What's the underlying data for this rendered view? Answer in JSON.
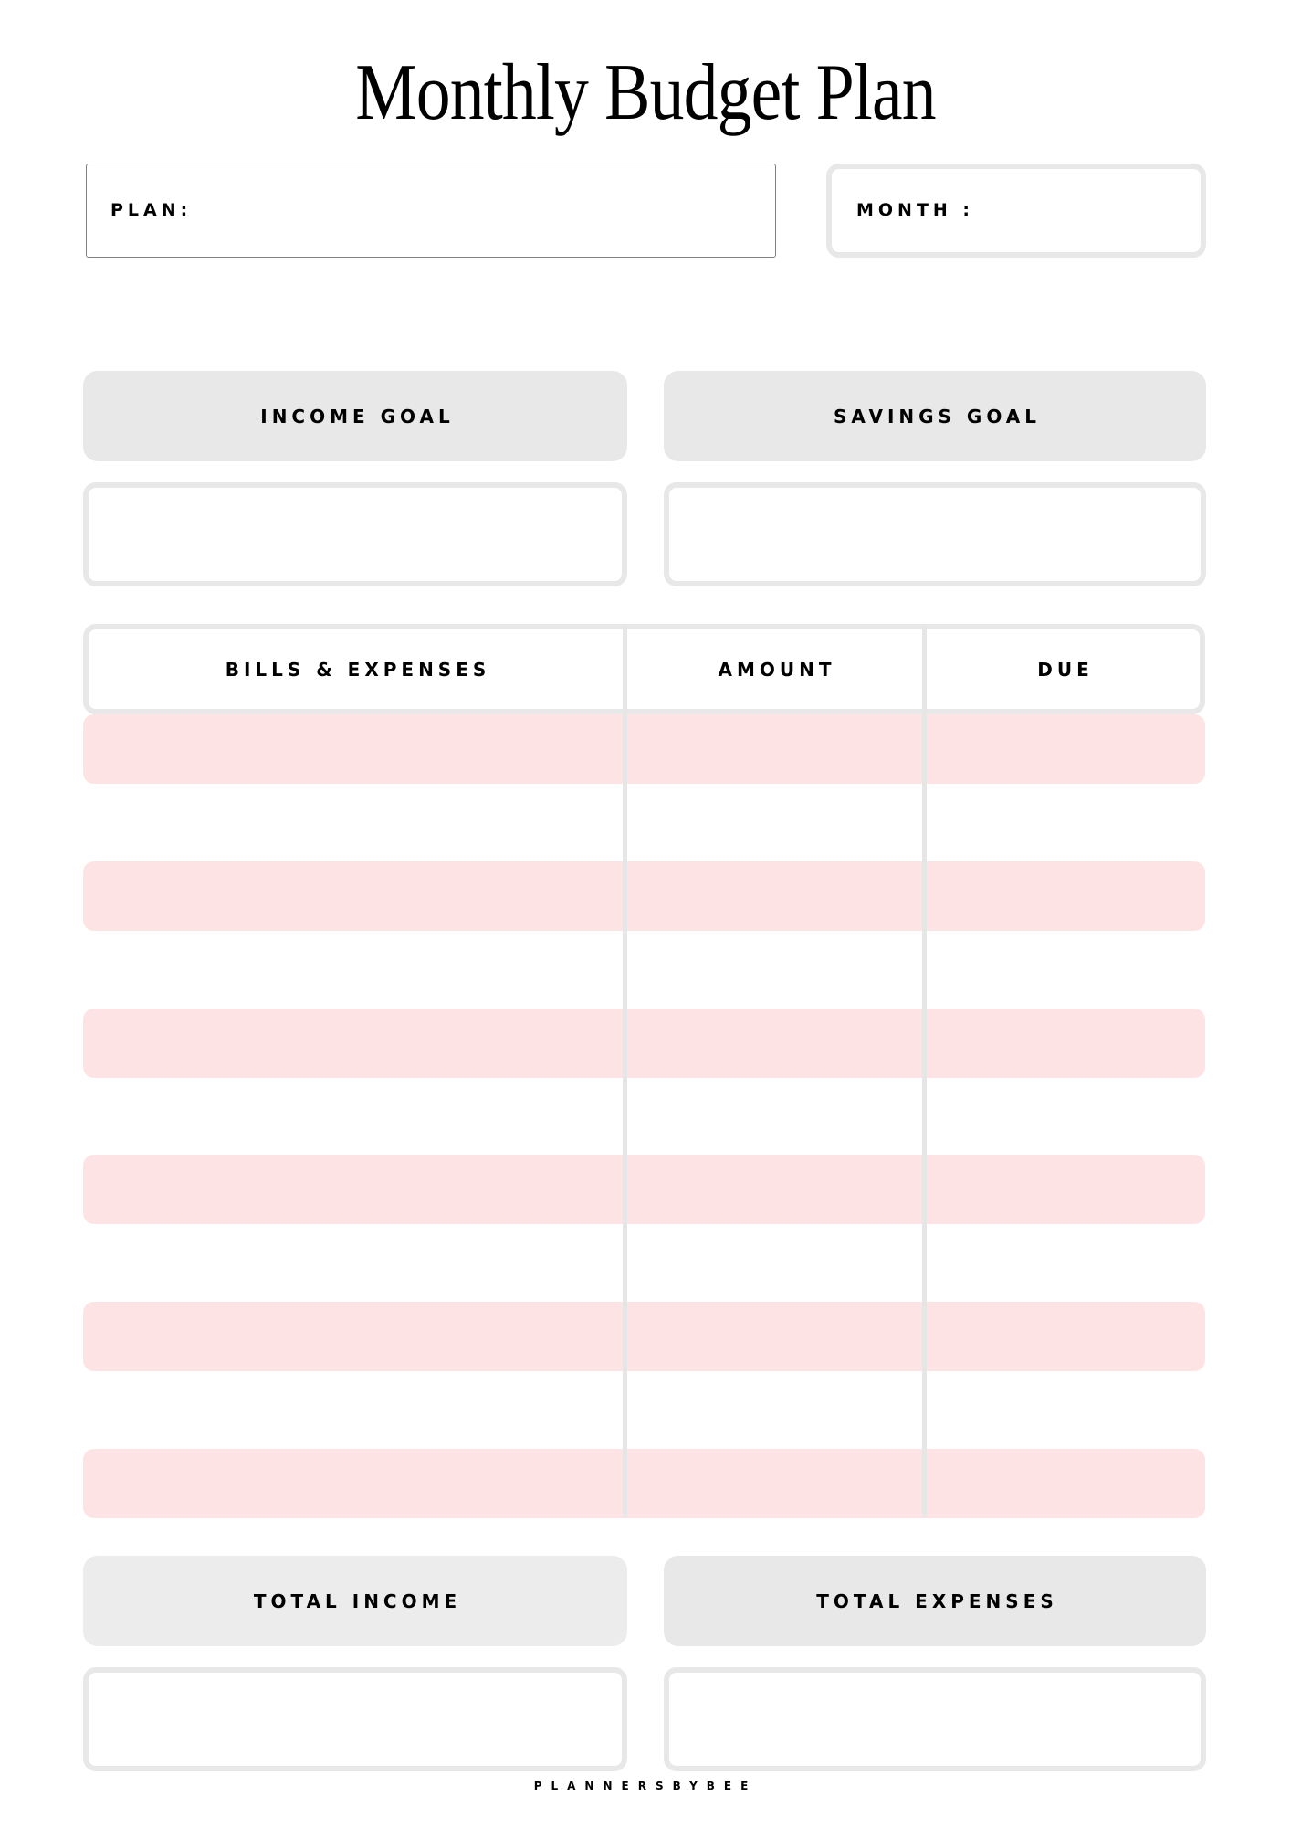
{
  "title": "Monthly Budget Plan",
  "fields": {
    "plan_label": "PLAN:",
    "plan_value": "",
    "month_label": "MONTH :",
    "month_value": ""
  },
  "goals": {
    "income_goal_label": "INCOME GOAL",
    "income_goal_value": "",
    "savings_goal_label": "SAVINGS GOAL",
    "savings_goal_value": ""
  },
  "expenses_table": {
    "columns": [
      "BILLS & EXPENSES",
      "AMOUNT",
      "DUE"
    ],
    "rows": [
      {
        "bill": "",
        "amount": "",
        "due": "",
        "shaded": true
      },
      {
        "bill": "",
        "amount": "",
        "due": "",
        "shaded": false
      },
      {
        "bill": "",
        "amount": "",
        "due": "",
        "shaded": true
      },
      {
        "bill": "",
        "amount": "",
        "due": "",
        "shaded": false
      },
      {
        "bill": "",
        "amount": "",
        "due": "",
        "shaded": true
      },
      {
        "bill": "",
        "amount": "",
        "due": "",
        "shaded": false
      },
      {
        "bill": "",
        "amount": "",
        "due": "",
        "shaded": true
      },
      {
        "bill": "",
        "amount": "",
        "due": "",
        "shaded": false
      },
      {
        "bill": "",
        "amount": "",
        "due": "",
        "shaded": true
      },
      {
        "bill": "",
        "amount": "",
        "due": "",
        "shaded": false
      },
      {
        "bill": "",
        "amount": "",
        "due": "",
        "shaded": true
      }
    ]
  },
  "totals": {
    "total_income_label": "TOTAL INCOME",
    "total_income_value": "",
    "total_expenses_label": "TOTAL EXPENSES",
    "total_expenses_value": ""
  },
  "footer": "PLANNERSBYBEE",
  "colors": {
    "header_fill": "#e8e8e8",
    "box_border": "#e8e8e8",
    "row_shade": "#fde3e4",
    "text": "#000000"
  }
}
